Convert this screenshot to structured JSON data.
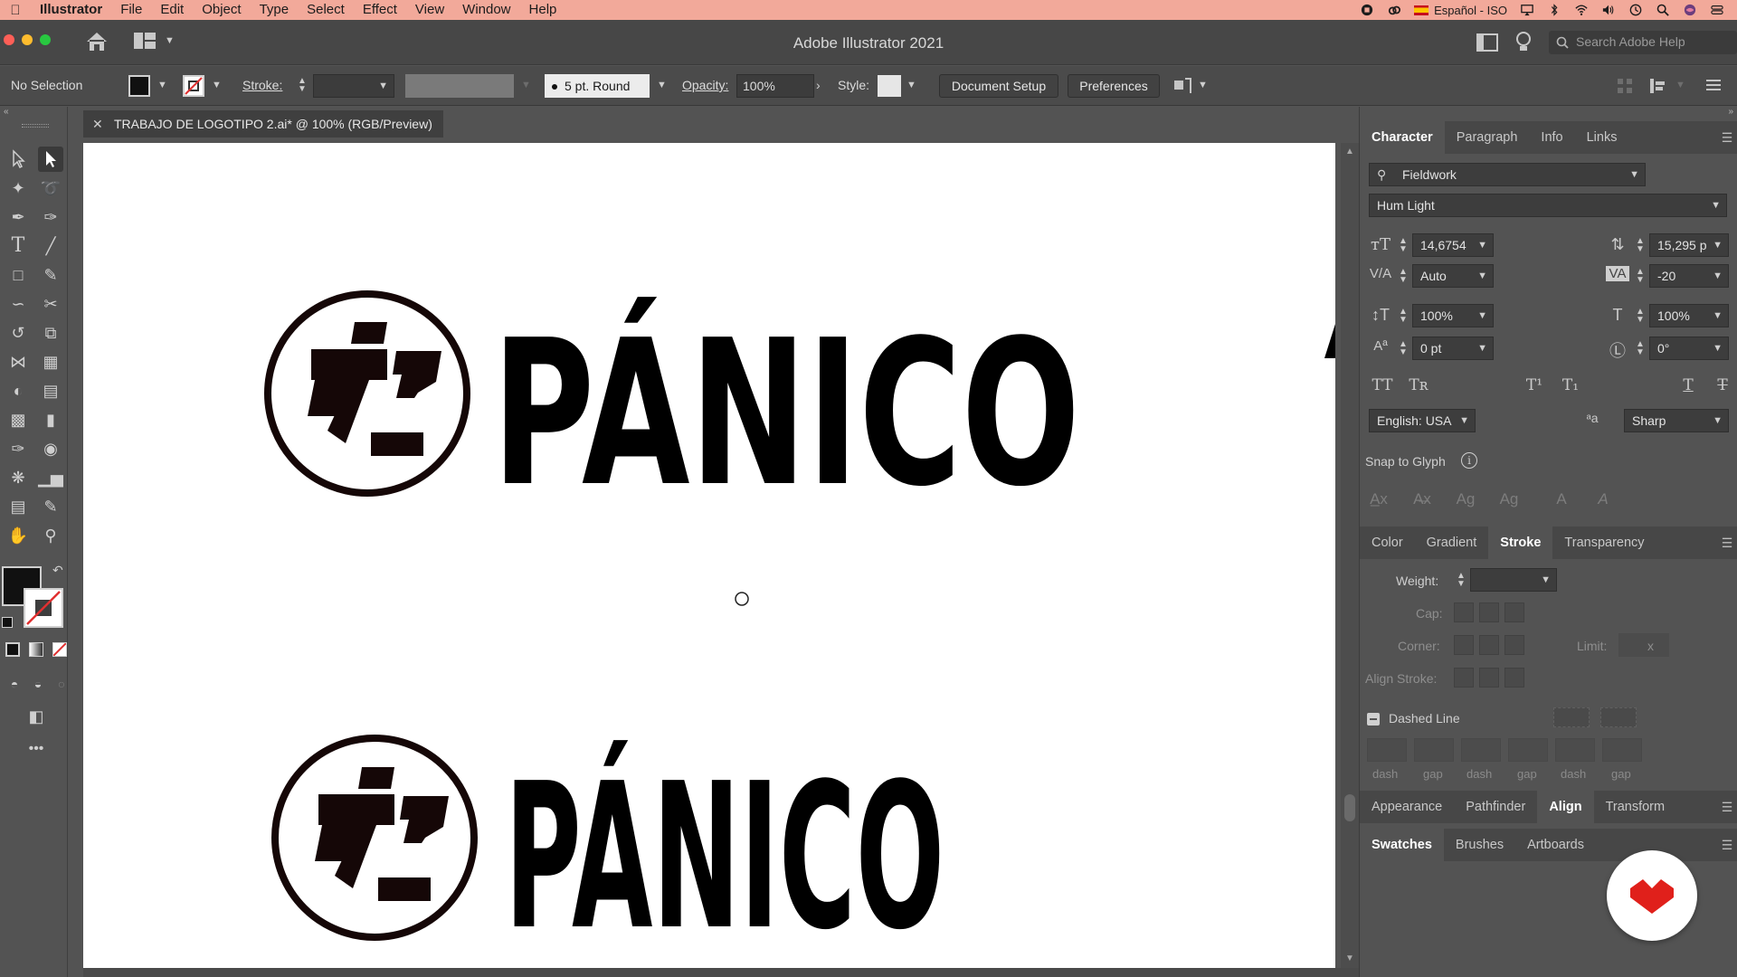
{
  "menubar": {
    "app_name": "Illustrator",
    "items": [
      "File",
      "Edit",
      "Object",
      "Type",
      "Select",
      "Effect",
      "View",
      "Window",
      "Help"
    ],
    "input_source": "Español - ISO"
  },
  "titlebar": {
    "title": "Adobe Illustrator 2021",
    "search_placeholder": "Search Adobe Help"
  },
  "control": {
    "selection": "No Selection",
    "stroke_label": "Stroke:",
    "brush": "5 pt. Round",
    "opacity_label": "Opacity:",
    "opacity_value": "100%",
    "style_label": "Style:",
    "document_setup": "Document Setup",
    "preferences": "Preferences"
  },
  "document": {
    "tab_title": "TRABAJO DE LOGOTIPO 2.ai* @ 100% (RGB/Preview)",
    "logo_text": "PÁNICO"
  },
  "character_panel": {
    "tabs": [
      "Character",
      "Paragraph",
      "Info",
      "Links"
    ],
    "font_search": "Fieldwork",
    "font_style": "Hum Light",
    "font_size": "14,6754",
    "leading": "15,295 p",
    "kerning": "Auto",
    "tracking": "-20",
    "vertical_scale": "100%",
    "horizontal_scale": "100%",
    "baseline_shift": "0 pt",
    "rotation": "0°",
    "language": "English: USA",
    "antialias": "Sharp",
    "snap_to_glyph": "Snap to Glyph"
  },
  "stroke_panel": {
    "tabs": [
      "Color",
      "Gradient",
      "Stroke",
      "Transparency"
    ],
    "weight_label": "Weight:",
    "cap_label": "Cap:",
    "corner_label": "Corner:",
    "limit_label": "Limit:",
    "limit_suffix": "x",
    "align_label": "Align Stroke:",
    "dashed_line": "Dashed Line",
    "dash_labels": [
      "dash",
      "gap",
      "dash",
      "gap",
      "dash",
      "gap"
    ]
  },
  "appearance_panel": {
    "tabs": [
      "Appearance",
      "Pathfinder",
      "Align",
      "Transform"
    ]
  },
  "swatches_panel": {
    "tabs": [
      "Swatches",
      "Brushes",
      "Artboards"
    ]
  },
  "colors": {
    "menubar": "#f2a99a",
    "logo_ink": "#150707",
    "badge_red": "#e0201b"
  }
}
